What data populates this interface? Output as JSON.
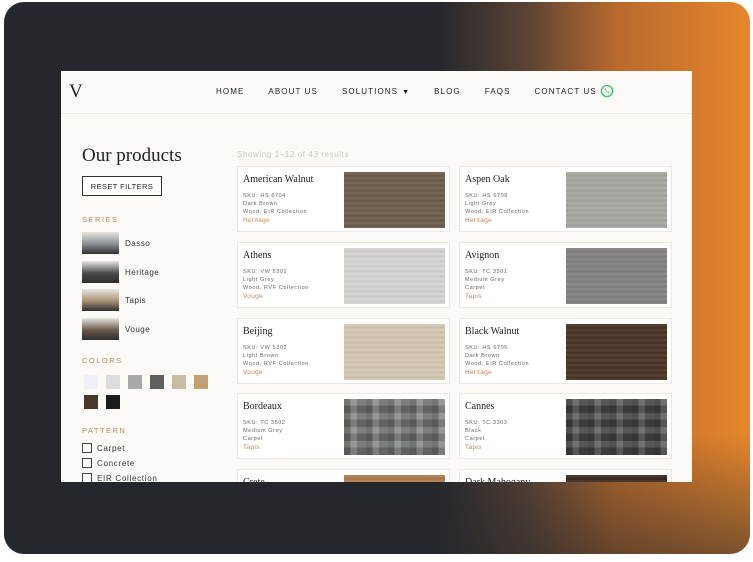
{
  "header": {
    "logo": "V",
    "nav": [
      {
        "label": "HOME",
        "dropdown": false
      },
      {
        "label": "ABOUT US",
        "dropdown": false
      },
      {
        "label": "SOLUTIONS",
        "dropdown": true
      },
      {
        "label": "BLOG",
        "dropdown": false
      },
      {
        "label": "FAQS",
        "dropdown": false
      },
      {
        "label": "CONTACT US",
        "dropdown": false
      }
    ],
    "whatsapp_icon": "whatsapp-icon",
    "whatsapp_color": "#3ec76a"
  },
  "sidebar": {
    "title": "Our products",
    "reset_label": "RESET FILTERS",
    "series_label": "SERIES",
    "series": [
      {
        "name": "Dasso",
        "color": "#8a8e93"
      },
      {
        "name": "Heritage",
        "color": "#4a4b4c"
      },
      {
        "name": "Tapis",
        "color": "#a88f74"
      },
      {
        "name": "Vouge",
        "color": "#6a5a4c"
      }
    ],
    "colors_label": "COLORS",
    "colors": [
      "#f1f0f7",
      "#dcdcdc",
      "#a9a9a7",
      "#5f5f5f",
      "#c9bca6",
      "#c2a070",
      "#473a2d",
      "#1c1c1c"
    ],
    "pattern_label": "PATTERN",
    "patterns": [
      "Carpet",
      "Concrete",
      "EIR Collection"
    ]
  },
  "results": {
    "count_text": "Showing 1–12 of 43 results",
    "products": [
      {
        "name": "American Walnut",
        "sku": "SKU: HS 6704",
        "color": "Dark Brown",
        "type": "Wood, EIR Collection",
        "series": "Heritage",
        "swatch": "#6d5d4b",
        "texture": "wood"
      },
      {
        "name": "Aspen Oak",
        "sku": "SKU: HS 6708",
        "color": "Light Grey",
        "type": "Wood, EIR Collection",
        "series": "Heritage",
        "swatch": "#a7a6a1",
        "texture": "wood"
      },
      {
        "name": "Athens",
        "sku": "SKU: VW 5301",
        "color": "Light Grey",
        "type": "Wood, RVF Collection",
        "series": "Vouge",
        "swatch": "#d5d3cf",
        "texture": "wood"
      },
      {
        "name": "Avignon",
        "sku": "SKU: TC 3501",
        "color": "Medium Grey",
        "type": "Carpet",
        "series": "Tapis",
        "swatch": "#838281",
        "texture": "wood"
      },
      {
        "name": "Beijing",
        "sku": "SKU: VW 5302",
        "color": "Light Brown",
        "type": "Wood, RVF Collection",
        "series": "Vouge",
        "swatch": "#d3c7b2",
        "texture": "wood"
      },
      {
        "name": "Black Walnut",
        "sku": "SKU: HS 6705",
        "color": "Dark Brown",
        "type": "Wood, EIR Collection",
        "series": "Heritage",
        "swatch": "#4b3427",
        "texture": "wood"
      },
      {
        "name": "Bordeaux",
        "sku": "SKU: TC 3502",
        "color": "Medium Grey",
        "type": "Carpet",
        "series": "Tapis",
        "swatch": "#7b7d79",
        "texture": "carpet"
      },
      {
        "name": "Cannes",
        "sku": "SKU: TC 3303",
        "color": "Black",
        "type": "Carpet",
        "series": "Tapis",
        "swatch": "#4a4c4c",
        "texture": "carpet"
      },
      {
        "name": "Crete",
        "sku": "",
        "color": "",
        "type": "",
        "series": "",
        "swatch": "#b07a50",
        "texture": "wood"
      },
      {
        "name": "Dark Mahogany",
        "sku": "",
        "color": "",
        "type": "",
        "series": "",
        "swatch": "#3a2b24",
        "texture": "wood"
      }
    ]
  }
}
